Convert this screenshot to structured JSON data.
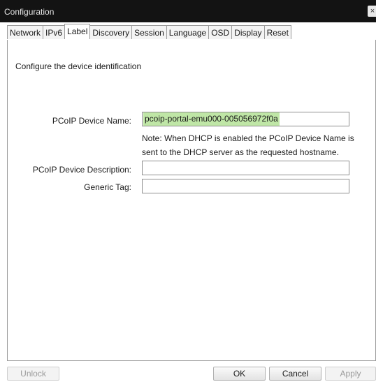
{
  "window": {
    "title": "Configuration",
    "close_glyph": "×"
  },
  "tabs": [
    {
      "label": "Network"
    },
    {
      "label": "IPv6"
    },
    {
      "label": "Label",
      "active": true
    },
    {
      "label": "Discovery"
    },
    {
      "label": "Session"
    },
    {
      "label": "Language"
    },
    {
      "label": "OSD"
    },
    {
      "label": "Display"
    },
    {
      "label": "Reset"
    }
  ],
  "label_tab": {
    "intro": "Configure the device identification",
    "device_name_label": "PCoIP Device Name:",
    "device_name_value": "pcoip-portal-emu000-005056972f0a",
    "note": "Note: When DHCP is enabled the PCoIP Device Name is sent to the DHCP server as the requested hostname.",
    "description_label": "PCoIP Device Description:",
    "description_value": "",
    "generic_tag_label": "Generic Tag:",
    "generic_tag_value": ""
  },
  "footer": {
    "unlock_label": "Unlock",
    "ok_label": "OK",
    "cancel_label": "Cancel",
    "apply_label": "Apply"
  },
  "colors": {
    "titlebar": "#131313",
    "highlight": "#bfe6a6"
  }
}
